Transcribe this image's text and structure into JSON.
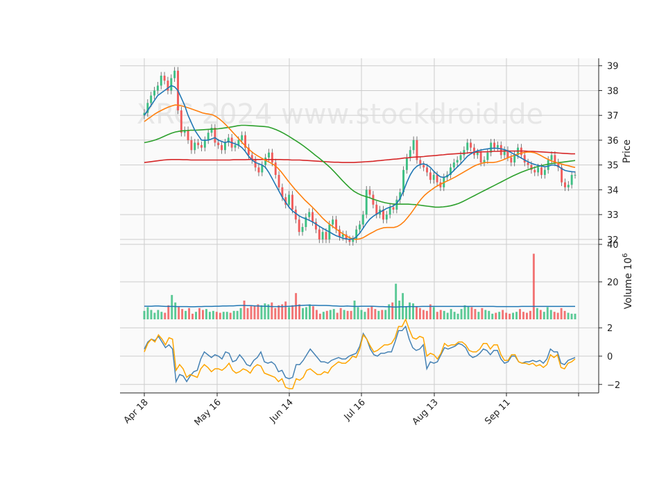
{
  "watermark": "XRC 2024 www.stockdroid.de",
  "colors": {
    "up": "#3dbf83",
    "down": "#f05c5c",
    "ma_fast": "#1f77b4",
    "ma_mid": "#ff7f0e",
    "ma_slow": "#2ca02c",
    "ma_long": "#d62728",
    "volume_ma": "#1f77b4",
    "osc_blue": "#4682b4",
    "osc_orange": "#ffa500",
    "grid": "#cccccc",
    "panel_bg": "#fafafa"
  },
  "chart_data": {
    "type": "candlestick",
    "x_axis": {
      "tick_labels": [
        "Apr 18",
        "May 16",
        "Jun 14",
        "Jul 16",
        "Aug 13",
        "Sep 11",
        ""
      ]
    },
    "price_panel": {
      "ylabel": "Price",
      "ylim": [
        31.8,
        39.3
      ],
      "yticks": [
        32,
        33,
        34,
        35,
        36,
        37,
        38,
        39
      ],
      "candles_close": [
        37.1,
        37.5,
        37.8,
        38.0,
        38.2,
        38.6,
        38.4,
        38.0,
        38.5,
        38.8,
        37.2,
        36.3,
        36.4,
        36.0,
        35.6,
        35.9,
        35.8,
        35.7,
        36.0,
        36.3,
        36.5,
        35.9,
        35.8,
        35.6,
        35.9,
        36.1,
        35.7,
        35.8,
        36.0,
        36.2,
        35.7,
        35.4,
        35.2,
        34.9,
        34.7,
        35.0,
        35.3,
        35.5,
        35.1,
        34.6,
        34.1,
        33.7,
        33.4,
        33.8,
        33.2,
        32.8,
        32.3,
        32.5,
        32.9,
        33.1,
        32.7,
        32.4,
        32.0,
        32.3,
        32.0,
        32.6,
        32.8,
        32.4,
        32.1,
        32.2,
        32.0,
        31.9,
        32.0,
        32.4,
        32.6,
        33.0,
        34.0,
        33.8,
        33.4,
        33.0,
        33.2,
        32.8,
        33.0,
        33.3,
        33.2,
        33.6,
        33.9,
        34.8,
        35.3,
        35.6,
        36.0,
        35.2,
        35.0,
        34.9,
        34.7,
        34.4,
        34.6,
        34.3,
        34.1,
        34.5,
        34.6,
        34.9,
        35.1,
        35.2,
        35.4,
        35.6,
        35.9,
        35.7,
        35.4,
        35.5,
        35.1,
        35.2,
        35.5,
        35.9,
        35.7,
        35.8,
        35.4,
        35.6,
        35.3,
        35.1,
        35.4,
        35.7,
        35.4,
        35.1,
        35.0,
        34.8,
        34.7,
        34.9,
        34.6,
        34.8,
        35.2,
        35.4,
        35.1,
        34.9,
        34.3,
        34.1,
        34.2,
        34.6,
        34.6
      ],
      "ma_fast": [
        37.0,
        37.2,
        37.4,
        37.6,
        37.8,
        37.9,
        38.0,
        38.1,
        38.2,
        38.15,
        38.0,
        37.7,
        37.4,
        37.0,
        36.7,
        36.4,
        36.2,
        36.0,
        36.0,
        36.0,
        36.05,
        36.1,
        36.0,
        35.95,
        35.9,
        35.95,
        35.9,
        35.85,
        35.8,
        35.7,
        35.55,
        35.35,
        35.2,
        35.1,
        35.05,
        35.0,
        34.9,
        34.7,
        34.45,
        34.2,
        33.95,
        33.7,
        33.5,
        33.3,
        33.15,
        33.05,
        32.95,
        32.88,
        32.83,
        32.77,
        32.7,
        32.62,
        32.53,
        32.45,
        32.37,
        32.3,
        32.22,
        32.15,
        32.1,
        32.05,
        32.02,
        32.0,
        32.02,
        32.1,
        32.25,
        32.45,
        32.65,
        32.82,
        32.93,
        33.02,
        33.1,
        33.17,
        33.25,
        33.3,
        33.35,
        33.45,
        33.65,
        33.95,
        34.3,
        34.6,
        34.82,
        34.95,
        35.02,
        35.05,
        35.0,
        34.9,
        34.75,
        34.62,
        34.52,
        34.5,
        34.55,
        34.65,
        34.78,
        34.92,
        35.05,
        35.2,
        35.35,
        35.45,
        35.52,
        35.57,
        35.6,
        35.63,
        35.65,
        35.67,
        35.68,
        35.67,
        35.65,
        35.62,
        35.57,
        35.5,
        35.42,
        35.35,
        35.28,
        35.2,
        35.13,
        35.07,
        35.02,
        34.98,
        34.95,
        34.93,
        34.95,
        35.0,
        35.0,
        34.95,
        34.85,
        34.78,
        34.75,
        34.73,
        34.72
      ],
      "ma_mid": [
        36.75,
        36.85,
        36.95,
        37.05,
        37.13,
        37.2,
        37.27,
        37.33,
        37.38,
        37.42,
        37.41,
        37.38,
        37.34,
        37.3,
        37.25,
        37.2,
        37.15,
        37.1,
        37.07,
        37.05,
        37.02,
        36.95,
        36.85,
        36.73,
        36.6,
        36.45,
        36.3,
        36.15,
        36.0,
        35.85,
        35.7,
        35.58,
        35.47,
        35.38,
        35.3,
        35.22,
        35.15,
        35.08,
        35.0,
        34.88,
        34.73,
        34.55,
        34.37,
        34.2,
        34.03,
        33.88,
        33.73,
        33.58,
        33.45,
        33.32,
        33.18,
        33.03,
        32.88,
        32.75,
        32.63,
        32.53,
        32.43,
        32.33,
        32.23,
        32.15,
        32.07,
        32.02,
        32.0,
        32.02,
        32.07,
        32.15,
        32.23,
        32.3,
        32.38,
        32.43,
        32.47,
        32.48,
        32.48,
        32.48,
        32.52,
        32.6,
        32.72,
        32.88,
        33.05,
        33.25,
        33.45,
        33.63,
        33.78,
        33.9,
        34.0,
        34.1,
        34.18,
        34.25,
        34.32,
        34.38,
        34.45,
        34.52,
        34.6,
        34.68,
        34.76,
        34.84,
        34.92,
        34.99,
        35.04,
        35.08,
        35.1,
        35.1,
        35.1,
        35.12,
        35.16,
        35.21,
        35.27,
        35.33,
        35.38,
        35.43,
        35.47,
        35.5,
        35.52,
        35.52,
        35.5,
        35.45,
        35.38,
        35.3,
        35.23,
        35.17,
        35.12,
        35.08,
        35.04,
        35.0,
        34.97,
        34.93,
        34.9
      ],
      "ma_slow": [
        35.9,
        35.93,
        35.97,
        36.02,
        36.08,
        36.15,
        36.22,
        36.28,
        36.33,
        36.36,
        36.38,
        36.39,
        36.4,
        36.4,
        36.41,
        36.42,
        36.43,
        36.44,
        36.45,
        36.46,
        36.48,
        36.5,
        36.52,
        36.55,
        36.58,
        36.6,
        36.6,
        36.59,
        36.58,
        36.57,
        36.56,
        36.55,
        36.53,
        36.48,
        36.42,
        36.35,
        36.27,
        36.18,
        36.08,
        35.98,
        35.88,
        35.77,
        35.65,
        35.53,
        35.4,
        35.28,
        35.15,
        35.02,
        34.88,
        34.72,
        34.55,
        34.38,
        34.22,
        34.07,
        33.94,
        33.85,
        33.78,
        33.73,
        33.68,
        33.62,
        33.57,
        33.52,
        33.48,
        33.45,
        33.43,
        33.42,
        33.42,
        33.42,
        33.42,
        33.41,
        33.4,
        33.38,
        33.36,
        33.34,
        33.32,
        33.3,
        33.3,
        33.31,
        33.33,
        33.36,
        33.4,
        33.45,
        33.52,
        33.6,
        33.68,
        33.76,
        33.84,
        33.92,
        34.0,
        34.08,
        34.16,
        34.24,
        34.32,
        34.4,
        34.48,
        34.56,
        34.63,
        34.7,
        34.76,
        34.82,
        34.87,
        34.92,
        34.96,
        35.0,
        35.03,
        35.06,
        35.08,
        35.1,
        35.12,
        35.14,
        35.16,
        35.18
      ],
      "ma_long": [
        35.1,
        35.12,
        35.14,
        35.16,
        35.18,
        35.2,
        35.21,
        35.22,
        35.22,
        35.22,
        35.21,
        35.21,
        35.2,
        35.2,
        35.2,
        35.2,
        35.2,
        35.2,
        35.2,
        35.2,
        35.2,
        35.2,
        35.2,
        35.21,
        35.21,
        35.21,
        35.21,
        35.22,
        35.22,
        35.22,
        35.22,
        35.22,
        35.22,
        35.22,
        35.22,
        35.22,
        35.21,
        35.21,
        35.2,
        35.2,
        35.2,
        35.19,
        35.18,
        35.17,
        35.16,
        35.15,
        35.14,
        35.13,
        35.12,
        35.11,
        35.11,
        35.1,
        35.1,
        35.1,
        35.1,
        35.11,
        35.12,
        35.13,
        35.14,
        35.15,
        35.17,
        35.18,
        35.2,
        35.21,
        35.23,
        35.24,
        35.26,
        35.28,
        35.29,
        35.31,
        35.32,
        35.33,
        35.34,
        35.36,
        35.37,
        35.38,
        35.4,
        35.41,
        35.43,
        35.44,
        35.45,
        35.46,
        35.47,
        35.48,
        35.5,
        35.51,
        35.52,
        35.53,
        35.53,
        35.54,
        35.55,
        35.55,
        35.56,
        35.56,
        35.56,
        35.56,
        35.56,
        35.56,
        35.56,
        35.55,
        35.55,
        35.54,
        35.53,
        35.52,
        35.51,
        35.5,
        35.49,
        35.48,
        35.47,
        35.46,
        35.45,
        35.45
      ]
    },
    "volume_panel": {
      "ylabel": "Volume  10^6",
      "ylim": [
        0,
        40
      ],
      "yticks": [
        20,
        40
      ],
      "values": [
        4.5,
        6.5,
        5.0,
        3.5,
        5.0,
        4.0,
        3.5,
        7.5,
        13.0,
        9.0,
        6.5,
        5.5,
        4.5,
        6.0,
        3.0,
        4.0,
        6.0,
        5.0,
        5.5,
        4.0,
        4.5,
        4.0,
        3.5,
        4.0,
        4.0,
        3.5,
        4.5,
        4.5,
        6.0,
        10.0,
        6.0,
        7.0,
        7.0,
        8.0,
        7.5,
        8.5,
        8.0,
        9.0,
        6.0,
        7.5,
        8.0,
        9.5,
        6.5,
        7.5,
        14.0,
        8.0,
        6.0,
        6.5,
        8.0,
        7.0,
        5.0,
        3.0,
        4.0,
        4.5,
        5.0,
        5.5,
        3.5,
        6.0,
        5.0,
        4.5,
        4.5,
        10.0,
        6.5,
        5.0,
        4.0,
        6.0,
        7.0,
        5.5,
        4.5,
        5.0,
        5.0,
        8.0,
        9.0,
        19.0,
        10.0,
        14.0,
        7.0,
        9.0,
        8.5,
        7.0,
        6.0,
        5.0,
        4.5,
        8.0,
        6.5,
        4.0,
        5.0,
        4.5,
        3.5,
        5.5,
        4.0,
        3.0,
        5.5,
        7.5,
        7.0,
        6.5,
        5.5,
        4.0,
        6.0,
        5.0,
        4.5,
        3.0,
        3.5,
        4.0,
        5.0,
        3.5,
        3.0,
        3.5,
        4.0,
        5.5,
        4.0,
        3.5,
        4.5,
        35.0,
        6.0,
        5.0,
        4.0,
        6.5,
        5.0,
        4.0,
        3.5,
        6.0,
        4.5,
        3.5,
        3.0,
        3.0
      ],
      "ma": [
        7.0,
        7.0,
        7.0,
        7.1,
        7.1,
        7.0,
        6.9,
        6.9,
        6.9,
        6.8,
        6.8,
        6.8,
        6.8,
        6.7,
        6.7,
        6.8,
        6.8,
        6.9,
        6.9,
        6.9,
        7.0,
        7.0,
        7.1,
        7.1,
        7.2,
        7.2,
        7.3,
        7.4,
        7.4,
        7.3,
        7.3,
        7.2,
        7.1,
        7.0,
        7.0,
        6.9,
        6.8,
        6.8,
        6.8,
        6.8,
        6.9,
        7.0,
        7.1,
        7.3,
        7.4,
        7.5,
        7.6,
        7.5,
        7.5,
        7.4,
        7.4,
        7.4,
        7.3,
        7.2,
        7.1,
        7.0,
        7.0,
        7.1,
        7.0,
        6.9,
        6.9,
        7.0,
        7.0,
        7.0,
        7.0,
        6.9,
        6.8,
        6.8,
        6.7,
        6.7,
        6.6,
        6.6,
        6.7,
        6.7,
        6.8,
        6.8,
        6.8,
        6.8,
        6.9,
        6.9,
        6.9,
        6.9,
        6.9,
        6.9,
        6.9,
        6.9,
        6.9,
        6.9,
        6.9,
        6.9,
        6.9,
        6.9,
        6.9,
        6.9,
        6.9,
        6.9,
        6.9,
        6.9,
        6.9,
        6.8,
        6.8,
        6.8,
        6.8,
        6.8,
        6.8,
        6.8,
        6.9,
        6.9,
        6.9,
        6.9,
        6.9,
        6.9,
        6.9,
        6.9,
        6.9,
        6.9,
        6.9,
        6.9,
        6.9,
        6.9,
        6.9,
        6.9
      ]
    },
    "oscillator_panel": {
      "ylim": [
        -2.6,
        2.6
      ],
      "yticks": [
        -2,
        0,
        2
      ],
      "series": [
        {
          "color_key": "osc_blue",
          "values": [
            0.5,
            1.0,
            1.2,
            1.1,
            1.4,
            1.0,
            0.6,
            0.8,
            0.5,
            -1.8,
            -1.3,
            -1.4,
            -1.8,
            -1.4,
            -1.1,
            -1.0,
            -0.2,
            0.3,
            0.1,
            -0.1,
            0.1,
            0.0,
            -0.2,
            0.3,
            0.2,
            -0.4,
            -0.3,
            0.1,
            -0.2,
            -0.6,
            -0.7,
            -0.3,
            -0.1,
            0.3,
            -0.4,
            -0.5,
            -0.4,
            -0.6,
            -1.1,
            -1.0,
            -1.5,
            -1.6,
            -1.5,
            -0.6,
            -0.6,
            -0.3,
            0.1,
            0.5,
            0.2,
            -0.1,
            -0.4,
            -0.4,
            -0.5,
            -0.3,
            -0.2,
            -0.1,
            -0.2,
            -0.2,
            0.0,
            0.1,
            0.2,
            0.7,
            1.6,
            1.2,
            0.5,
            0.1,
            0.0,
            0.2,
            0.2,
            0.3,
            0.3,
            1.0,
            1.8,
            1.8,
            2.1,
            1.2,
            0.6,
            0.4,
            0.5,
            0.8,
            -0.9,
            -0.4,
            -0.5,
            -0.4,
            0.1,
            0.6,
            0.5,
            0.6,
            0.7,
            0.9,
            0.8,
            0.6,
            0.1,
            -0.1,
            0.0,
            0.2,
            0.5,
            0.4,
            0.1,
            0.4,
            0.4,
            -0.2,
            -0.5,
            -0.4,
            0.0,
            0.0,
            -0.4,
            -0.5,
            -0.4,
            -0.4,
            -0.3,
            -0.4,
            -0.3,
            -0.5,
            -0.2,
            0.5,
            0.3,
            0.3,
            -0.5,
            -0.6,
            -0.3,
            -0.2,
            -0.1
          ]
        },
        {
          "color_key": "osc_orange",
          "values": [
            0.3,
            0.9,
            1.2,
            1.0,
            1.5,
            1.2,
            0.8,
            1.3,
            1.2,
            -1.0,
            -0.6,
            -0.9,
            -1.5,
            -1.3,
            -1.4,
            -1.5,
            -0.9,
            -0.6,
            -0.8,
            -1.1,
            -0.9,
            -0.9,
            -1.0,
            -0.8,
            -0.5,
            -1.0,
            -1.2,
            -1.1,
            -0.9,
            -1.0,
            -1.2,
            -0.8,
            -0.6,
            -0.7,
            -1.2,
            -1.3,
            -1.4,
            -1.5,
            -1.8,
            -1.6,
            -2.2,
            -2.3,
            -2.3,
            -1.6,
            -1.7,
            -1.5,
            -1.0,
            -0.9,
            -1.1,
            -1.3,
            -1.3,
            -1.1,
            -1.2,
            -0.8,
            -0.6,
            -0.4,
            -0.5,
            -0.5,
            -0.3,
            0.0,
            -0.1,
            0.5,
            1.5,
            1.2,
            0.7,
            0.3,
            0.4,
            0.6,
            0.8,
            0.8,
            0.9,
            1.3,
            2.1,
            2.1,
            2.6,
            1.9,
            1.3,
            1.2,
            1.4,
            1.3,
            0.0,
            0.2,
            0.1,
            -0.2,
            0.2,
            0.9,
            0.7,
            0.8,
            0.8,
            1.0,
            1.0,
            0.8,
            0.4,
            0.3,
            0.3,
            0.5,
            0.9,
            0.9,
            0.5,
            0.8,
            0.8,
            0.1,
            -0.3,
            -0.3,
            0.1,
            0.1,
            -0.4,
            -0.5,
            -0.5,
            -0.6,
            -0.5,
            -0.7,
            -0.6,
            -0.8,
            -0.6,
            0.1,
            -0.1,
            0.1,
            -0.8,
            -0.9,
            -0.5,
            -0.4,
            -0.2
          ]
        }
      ]
    }
  }
}
